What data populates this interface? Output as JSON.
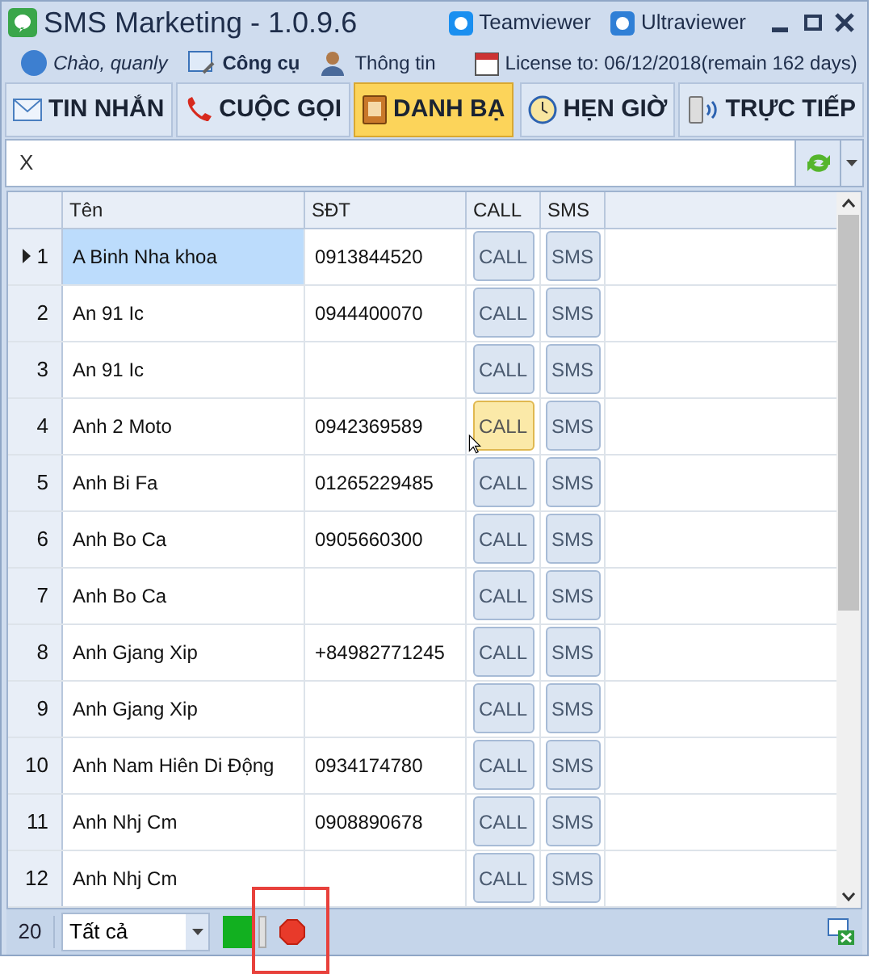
{
  "window": {
    "title": "SMS Marketing - 1.0.9.6"
  },
  "header_links": [
    {
      "label": "Teamviewer",
      "kind": "teamviewer"
    },
    {
      "label": "Ultraviewer",
      "kind": "ultraviewer"
    }
  ],
  "toolbar": {
    "greeting": "Chào, quanly",
    "tools": "Công cụ",
    "info": "Thông tin",
    "license": "License to: 06/12/2018(remain 162 days)"
  },
  "tabs": [
    {
      "label": "TIN NHẮN",
      "kind": "mail",
      "selected": false
    },
    {
      "label": "CUỘC GỌI",
      "kind": "phone",
      "selected": false
    },
    {
      "label": "DANH BẠ",
      "kind": "book",
      "selected": true
    },
    {
      "label": "HẸN GIỜ",
      "kind": "clock",
      "selected": false
    },
    {
      "label": "TRỰC TIẾP",
      "kind": "device",
      "selected": false
    }
  ],
  "search": {
    "value": "X"
  },
  "table": {
    "columns": [
      "Tên",
      "SĐT",
      "CALL",
      "SMS"
    ],
    "rows": [
      {
        "index": "1",
        "name": "A Binh Nha khoa",
        "phone": "0913844520",
        "call": "CALL",
        "sms": "SMS",
        "current": true,
        "selected": true,
        "hovered": false
      },
      {
        "index": "2",
        "name": "An 91 Ic",
        "phone": "0944400070",
        "call": "CALL",
        "sms": "SMS",
        "current": false,
        "selected": false,
        "hovered": false
      },
      {
        "index": "3",
        "name": "An 91 Ic",
        "call": "CALL",
        "sms": "SMS",
        "current": false,
        "selected": false,
        "hovered": false
      },
      {
        "index": "4",
        "name": "Anh 2 Moto",
        "phone": "0942369589",
        "call": "CALL",
        "sms": "SMS",
        "current": false,
        "selected": false,
        "hovered": true
      },
      {
        "index": "5",
        "name": "Anh Bi Fa",
        "phone": "01265229485",
        "call": "CALL",
        "sms": "SMS",
        "current": false,
        "selected": false,
        "hovered": false
      },
      {
        "index": "6",
        "name": "Anh Bo Ca",
        "phone": "0905660300",
        "call": "CALL",
        "sms": "SMS",
        "current": false,
        "selected": false,
        "hovered": false
      },
      {
        "index": "7",
        "name": "Anh Bo Ca",
        "call": "CALL",
        "sms": "SMS",
        "current": false,
        "selected": false,
        "hovered": false
      },
      {
        "index": "8",
        "name": "Anh Gjang Xip",
        "phone": "+84982771245",
        "call": "CALL",
        "sms": "SMS",
        "current": false,
        "selected": false,
        "hovered": false
      },
      {
        "index": "9",
        "name": "Anh Gjang Xip",
        "call": "CALL",
        "sms": "SMS",
        "current": false,
        "selected": false,
        "hovered": false
      },
      {
        "index": "10",
        "name": "Anh Nam Hiên Di Động",
        "phone": "0934174780",
        "call": "CALL",
        "sms": "SMS",
        "current": false,
        "selected": false,
        "hovered": false
      },
      {
        "index": "11",
        "name": "Anh Nhj Cm",
        "phone": "0908890678",
        "call": "CALL",
        "sms": "SMS",
        "current": false,
        "selected": false,
        "hovered": false
      },
      {
        "index": "12",
        "name": "Anh Nhj Cm",
        "call": "CALL",
        "sms": "SMS",
        "current": false,
        "selected": false,
        "hovered": false
      }
    ]
  },
  "status_bar": {
    "page_size": "20",
    "filter": "Tất cả"
  }
}
